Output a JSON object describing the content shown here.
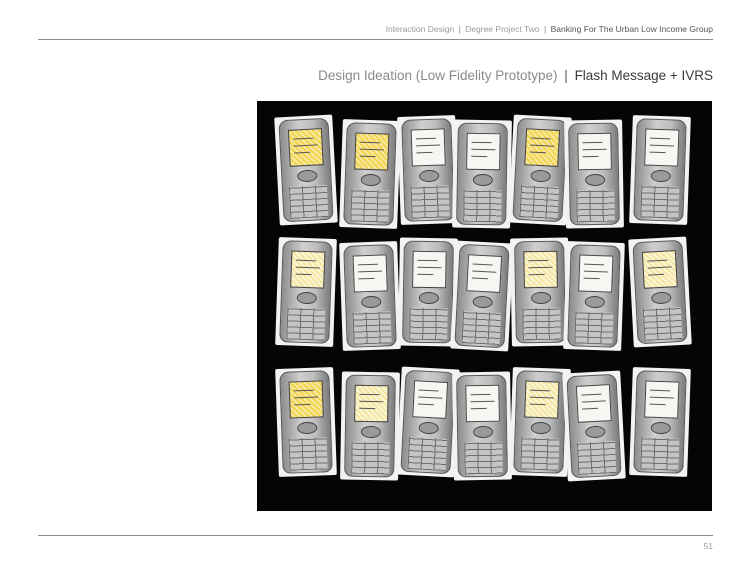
{
  "header": {
    "part1": "Interaction Design",
    "part2": "Degree Project Two",
    "part3": "Banking For The Urban Low Income Group",
    "separator": "|"
  },
  "title": {
    "light": "Design Ideation (Low Fidelity Prototype)",
    "separator": "|",
    "strong": "Flash Message + IVRS"
  },
  "page_number": "51",
  "photo": {
    "description_alt": "Paper prototypes of mobile phone screens",
    "rows": [
      [
        "yellow",
        "yellow",
        "white",
        "white",
        "yellow",
        "white",
        "white"
      ],
      [
        "lightyellow",
        "white",
        "white",
        "white",
        "lightyellow",
        "white",
        "lightyellow"
      ],
      [
        "yellow",
        "lightyellow",
        "white",
        "white",
        "lightyellow",
        "white",
        "white"
      ]
    ]
  }
}
